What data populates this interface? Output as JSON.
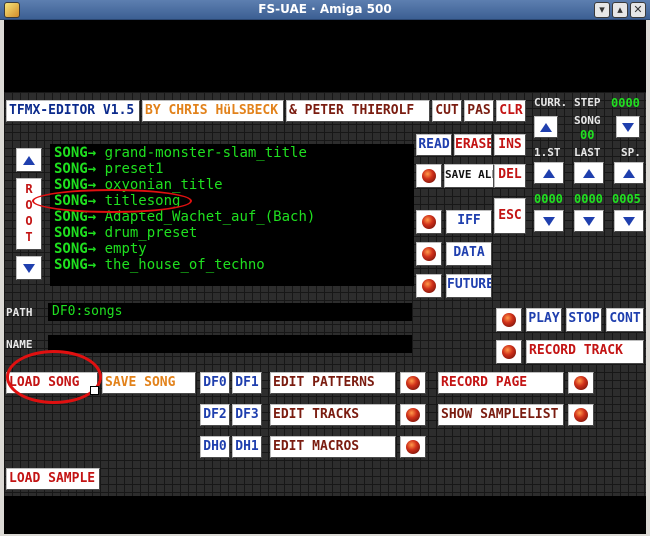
{
  "window": {
    "title": "FS-UAE · Amiga 500",
    "minimize_icon": "chevron-down-icon",
    "maximize_icon": "chevron-up-icon",
    "close_icon": "x-icon"
  },
  "header": {
    "editor": "TFMX-EDITOR V1.5",
    "author1": "BY CHRIS HüLSBECK",
    "author2": "& PETER THIEROLF",
    "cut": "CUT",
    "pas": "PAS",
    "clr": "CLR"
  },
  "song_panel": {
    "curr_label": "CURR.",
    "step_label": "STEP",
    "step_value": "0000",
    "song_label": "SONG",
    "song_value": "00",
    "first_st_label": "1.ST",
    "last_label": "LAST",
    "sp_label": "SP.",
    "first_st_value": "0000",
    "last_value": "0000",
    "sp_value": "0005"
  },
  "file_buttons": {
    "read": "READ",
    "erase": "ERASE",
    "ins": "INS",
    "save_all": "SAVE ALL",
    "del": "DEL",
    "iff": "IFF",
    "esc": "ESC",
    "data": "DATA",
    "future": "FUTURE"
  },
  "root_label": "ROOT",
  "songs": [
    {
      "tag": "SONG→",
      "name": "grand-monster-slam_title"
    },
    {
      "tag": "SONG→",
      "name": "preset1"
    },
    {
      "tag": "SONG→",
      "name": "oxyonian_title"
    },
    {
      "tag": "SONG→",
      "name": "titlesong"
    },
    {
      "tag": "SONG→",
      "name": "Adapted_Wachet_auf_(Bach)"
    },
    {
      "tag": "SONG→",
      "name": "drum_preset"
    },
    {
      "tag": "SONG→",
      "name": "empty"
    },
    {
      "tag": "SONG→",
      "name": "the_house_of_techno"
    }
  ],
  "path": {
    "label": "PATH",
    "value": "DF0:songs"
  },
  "name": {
    "label": "NAME",
    "value": ""
  },
  "transport": {
    "play": "PLAY",
    "stop": "STOP",
    "cont": "CONT",
    "record_track": "RECORD TRACK"
  },
  "bottom": {
    "load_song": "LOAD SONG",
    "save_song": "SAVE SONG",
    "df0": "DF0",
    "df1": "DF1",
    "df2": "DF2",
    "df3": "DF3",
    "dh0": "DH0",
    "dh1": "DH1",
    "edit_patterns": "EDIT PATTERNS",
    "edit_tracks": "EDIT TRACKS",
    "edit_macros": "EDIT MACROS",
    "record_page": "RECORD PAGE",
    "show_samplelist": "SHOW SAMPLELIST",
    "load_sample": "LOAD SAMPLE"
  },
  "colors": {
    "grid": "#2d2d2d",
    "accent_red": "#c31414",
    "accent_blue": "#1f3fae",
    "accent_orange": "#e2821b",
    "list_green": "#1fe01f",
    "annotation": "#e01010"
  }
}
